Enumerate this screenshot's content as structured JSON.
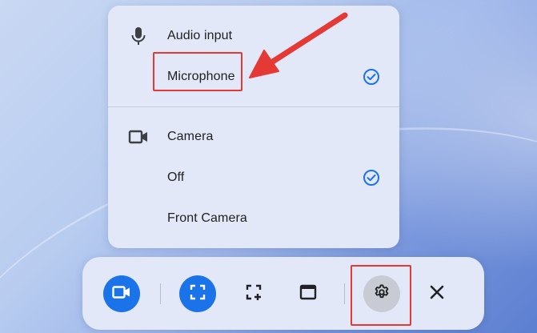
{
  "menu": {
    "audio_section": {
      "icon": "microphone-icon",
      "heading": "Audio input",
      "options": [
        {
          "label": "Microphone",
          "selected": true
        }
      ]
    },
    "camera_section": {
      "icon": "camera-icon",
      "heading": "Camera",
      "options": [
        {
          "label": "Off",
          "selected": true
        },
        {
          "label": "Front Camera",
          "selected": false
        }
      ]
    }
  },
  "toolbar": {
    "buttons": [
      {
        "name": "video-record-button",
        "icon": "video-camera-icon",
        "active": true
      },
      {
        "name": "capture-fullscreen-button",
        "icon": "fullscreen-capture-icon",
        "active": true
      },
      {
        "name": "capture-partial-button",
        "icon": "partial-capture-icon",
        "active": false
      },
      {
        "name": "capture-window-button",
        "icon": "window-capture-icon",
        "active": false
      },
      {
        "name": "settings-button",
        "icon": "gear-icon",
        "active": false
      },
      {
        "name": "close-button",
        "icon": "close-icon",
        "active": false
      }
    ]
  },
  "colors": {
    "accent": "#1a73e8",
    "annotation": "#e53935",
    "panel": "#e3e8f8"
  }
}
